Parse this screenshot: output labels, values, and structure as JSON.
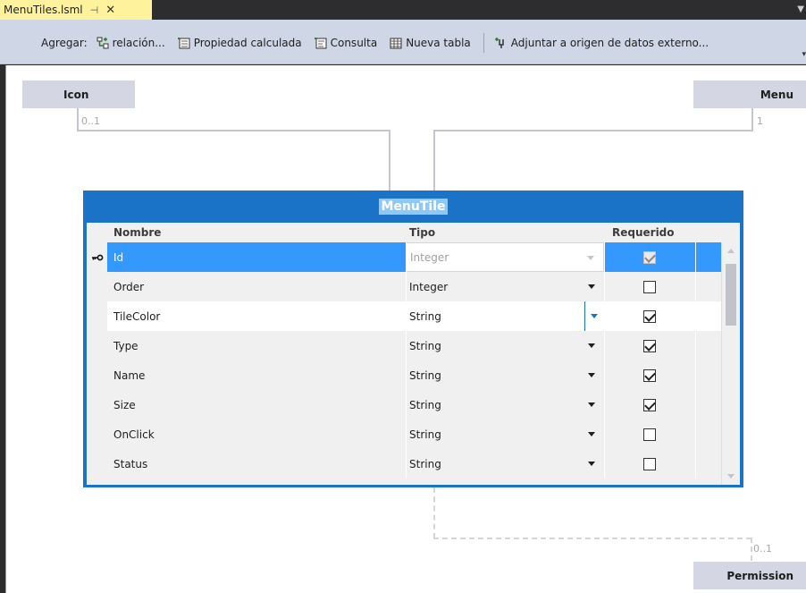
{
  "tab": {
    "title": "MenuTiles.lsml",
    "pin_glyph": "⊣",
    "close_glyph": "✕"
  },
  "toolbar": {
    "label": "Agregar:",
    "buttons": [
      {
        "icon": "relationship-icon",
        "label": "relación..."
      },
      {
        "icon": "computed-property-icon",
        "label": "Propiedad calculada"
      },
      {
        "icon": "query-icon",
        "label": "Consulta"
      },
      {
        "icon": "new-table-icon",
        "label": "Nueva tabla"
      }
    ],
    "attach_button": {
      "icon": "attach-datasource-icon",
      "label": "Adjuntar a origen de datos externo..."
    }
  },
  "diagram": {
    "entities": {
      "icon": {
        "name": "Icon",
        "multiplicity": "0..1"
      },
      "menu": {
        "name": "Menu",
        "multiplicity": "1"
      },
      "permission": {
        "name": "Permission",
        "multiplicity": "0..1"
      }
    },
    "table": {
      "title": "MenuTile",
      "columns": {
        "name": "Nombre",
        "type": "Tipo",
        "required": "Requerido"
      },
      "rows": [
        {
          "name": "Id",
          "type": "Integer",
          "required": true,
          "key": true,
          "state": "selected"
        },
        {
          "name": "Order",
          "type": "Integer",
          "required": false,
          "key": false,
          "state": ""
        },
        {
          "name": "TileColor",
          "type": "String",
          "required": true,
          "key": false,
          "state": "focused"
        },
        {
          "name": "Type",
          "type": "String",
          "required": true,
          "key": false,
          "state": ""
        },
        {
          "name": "Name",
          "type": "String",
          "required": true,
          "key": false,
          "state": ""
        },
        {
          "name": "Size",
          "type": "String",
          "required": true,
          "key": false,
          "state": ""
        },
        {
          "name": "OnClick",
          "type": "String",
          "required": false,
          "key": false,
          "state": ""
        },
        {
          "name": "Status",
          "type": "String",
          "required": false,
          "key": false,
          "state": ""
        }
      ]
    }
  },
  "colors": {
    "accent": "#1a73c6",
    "selection": "#3399ff",
    "tab": "#fff29d",
    "toolbar": "#cfd6e5",
    "entity": "#d4d6e3"
  }
}
